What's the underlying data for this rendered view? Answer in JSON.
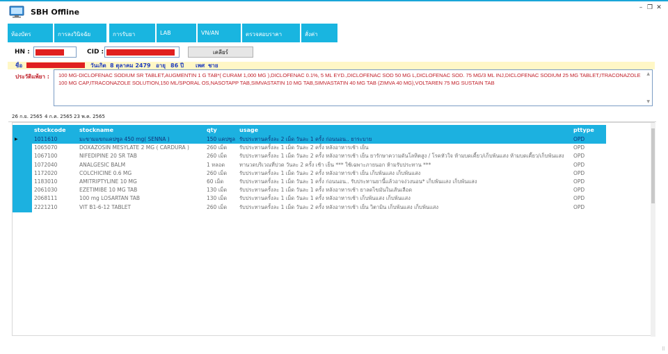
{
  "window": {
    "title": "SBH Offline",
    "minimize_glyph": "–",
    "restore_glyph": "❐",
    "close_glyph": "✕"
  },
  "toolbar": [
    {
      "label": "ห้องบัตร"
    },
    {
      "label": "การลงวินิจฉัย"
    },
    {
      "label": "การรับยา"
    },
    {
      "label": "LAB"
    },
    {
      "label": "VN/AN"
    },
    {
      "label": "ตรวจสอบราคา"
    },
    {
      "label": "สั่งค่า"
    }
  ],
  "search": {
    "hn_label": "HN :",
    "cid_label": "CID :",
    "clear_label": "เคลียร์"
  },
  "patient": {
    "name_label": "ชื่อ",
    "birth_label": "วันเกิด",
    "birth_value": "8 ตุลาคม 2479",
    "age_label": "อายุ",
    "age_value": "86",
    "age_unit": "ปี",
    "sex_label": "เพศ",
    "sex_value": "ชาย"
  },
  "history": {
    "label": "ประวัติแพ้ยา :",
    "text": "100 MG-DICLOFENAC SODIUM SR TABLET,AUGMENTIN 1 G TAB*( CURAM 1,000 MG ),DICLOFENAC 0.1%, 5 ML  EYD.,DICLOFENAC SOD 50 MG L,DICLOFENAC SOD. 75 MG/3 ML INJ,DICLOFENAC SODIUM 25 MG TABLET,ITRACONAZOLE 100 MG CAP,ITRACONAZOLE SOLUTION,150 ML/SPORAL OS,NASOTAPP TAB,SIMVASTATIN 10 MG TAB,SIMVASTATIN 40 MG TAB (ZIMVA 40 MG),VOLTAREN 75 MG SUSTAIN TAB"
  },
  "tabs": [
    {
      "label": "26 ก.ย. 2565"
    },
    {
      "label": "4 ก.ค. 2565"
    },
    {
      "label": "23 พ.ค. 2565"
    }
  ],
  "grid": {
    "columns": [
      "stockcode",
      "stockname",
      "qty",
      "usage",
      "pttype"
    ],
    "selected_marker": "▶",
    "rows": [
      {
        "stockcode": "1011610",
        "stockname": "มะขามแขกแคปซูล 450 mg( SENNA )",
        "qty": "150 แคปซูล",
        "usage": "รับประทานครั้งละ 2 เม็ด วันละ 1 ครั้ง ก่อนนอน.. ยาระบาย",
        "pttype": "OPD"
      },
      {
        "stockcode": "1065070",
        "stockname": "DOXAZOSIN MESYLATE 2 MG ( CARDURA )",
        "qty": "260 เม็ด",
        "usage": "รับประทานครั้งละ 1 เม็ด วันละ 2 ครั้ง หลังอาหารเช้า เย็น",
        "pttype": "OPD"
      },
      {
        "stockcode": "1067100",
        "stockname": "NIFEDIPINE 20 SR TAB",
        "qty": "260 เม็ด",
        "usage": "รับประทานครั้งละ 1 เม็ด วันละ 2 ครั้ง หลังอาหารเช้า เย็น ยารักษาความดันโลหิตสูง / โรคหัวใจ ห้ามบดเคี้ยว/เก็บพ้นแสง ห้ามบดเคี้ยว/เก็บพ้นแสง",
        "pttype": "OPD"
      },
      {
        "stockcode": "1072040",
        "stockname": "ANALGESIC  BALM",
        "qty": "1 หลอด",
        "usage": "ทานวดบริเวณที่ปวด   วันละ 2 ครั้ง เช้า เย็น *** ใช้เฉพาะภายนอก ห้ามรับประทาน ***",
        "pttype": "OPD"
      },
      {
        "stockcode": "1172020",
        "stockname": "COLCHICINE 0.6 MG",
        "qty": "260 เม็ด",
        "usage": "รับประทานครั้งละ 1 เม็ด วันละ 2 ครั้ง หลังอาหารเช้า เย็น เก็บพ้นแสง เก็บพ้นแสง",
        "pttype": "OPD"
      },
      {
        "stockcode": "1183010",
        "stockname": "AMITRIPTYLINE 10 MG",
        "qty": "60 เม็ด",
        "usage": "รับประทานครั้งละ 1 เม็ด วันละ 1 ครั้ง ก่อนนอน.. รับประทานยานี้แล้วอาจง่วงนอน* เก็บพ้นแสง เก็บพ้นแสง",
        "pttype": "OPD"
      },
      {
        "stockcode": "2061030",
        "stockname": "EZETIMIBE 10 MG TAB",
        "qty": "130 เม็ด",
        "usage": "รับประทานครั้งละ 1 เม็ด วันละ 1 ครั้ง หลังอาหารเช้า ยาลดไขมันในเส้นเลือด",
        "pttype": "OPD"
      },
      {
        "stockcode": "2068111",
        "stockname": "100 mg LOSARTAN TAB",
        "qty": "130 เม็ด",
        "usage": "รับประทานครั้งละ 1 เม็ด วันละ 1 ครั้ง หลังอาหารเช้า เก็บพ้นแสง เก็บพ้นแสง",
        "pttype": "OPD"
      },
      {
        "stockcode": "2221210",
        "stockname": "VIT B1-6-12 TABLET",
        "qty": "260 เม็ด",
        "usage": "รับประทานครั้งละ 1 เม็ด วันละ 2 ครั้ง หลังอาหารเช้า เย็น วิตามิน เก็บพ้นแสง เก็บพ้นแสง",
        "pttype": "OPD"
      }
    ]
  },
  "icons": {
    "app": "monitor-icon",
    "row_pointer": "triangle-right-icon",
    "resize": "resize-grip-icon"
  },
  "colors": {
    "accent": "#1cb1e0",
    "history_text": "#c0202a",
    "patient_info": "#1f3dbf",
    "patient_bar": "#fff7c6",
    "redaction": "#e02020"
  }
}
